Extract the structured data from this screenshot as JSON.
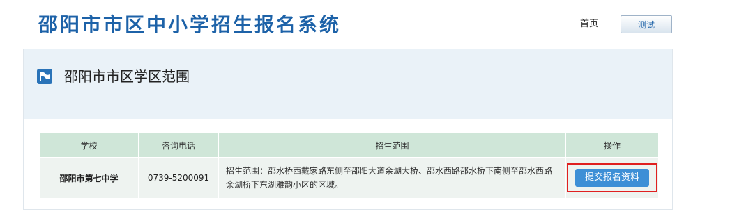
{
  "header": {
    "site_title": "邵阳市市区中小学招生报名系统",
    "nav_home": "首页",
    "nav_user": "测试"
  },
  "panel": {
    "title": "邵阳市市区学区范围",
    "icon": "flag-icon"
  },
  "table": {
    "columns": [
      "学校",
      "咨询电话",
      "招生范围",
      "操作"
    ],
    "rows": [
      {
        "school": "邵阳市第七中学",
        "phone": "0739-5200091",
        "scope": "招生范围：邵水桥西戴家路东侧至邵阳大道余湖大桥、邵水西路邵水桥下南侧至邵水西路余湖桥下东湖雅韵小区的区域。",
        "action": "提交报名资料"
      }
    ]
  },
  "colors": {
    "title_blue": "#1d62a8",
    "header_row": "#cfe6d8",
    "button": "#3d8fd6",
    "highlight": "#e02020"
  }
}
